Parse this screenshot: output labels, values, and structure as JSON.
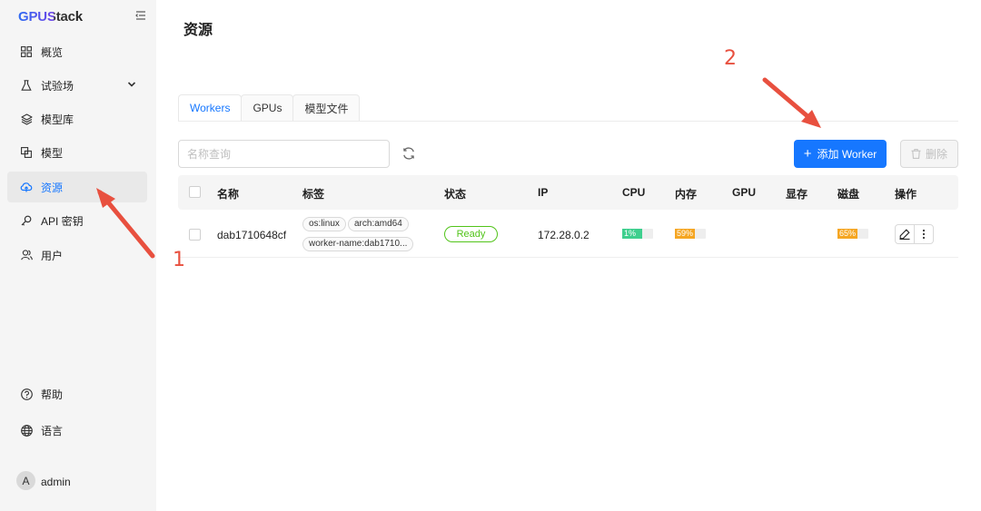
{
  "app": {
    "logo": "GPUStack"
  },
  "sidebar": {
    "items": [
      {
        "label": "概览",
        "icon": "dashboard-icon"
      },
      {
        "label": "试验场",
        "icon": "flask-icon",
        "expandable": true
      },
      {
        "label": "模型库",
        "icon": "layers-icon"
      },
      {
        "label": "模型",
        "icon": "models-icon"
      },
      {
        "label": "资源",
        "icon": "cloud-icon",
        "active": true
      },
      {
        "label": "API 密钥",
        "icon": "key-icon"
      },
      {
        "label": "用户",
        "icon": "users-icon"
      }
    ],
    "bottom": [
      {
        "label": "帮助",
        "icon": "help-icon"
      },
      {
        "label": "语言",
        "icon": "globe-icon"
      }
    ],
    "user": {
      "avatar_letter": "A",
      "name": "admin"
    }
  },
  "page": {
    "title": "资源"
  },
  "tabs": [
    {
      "label": "Workers",
      "active": true
    },
    {
      "label": "GPUs"
    },
    {
      "label": "模型文件"
    }
  ],
  "toolbar": {
    "search_placeholder": "名称查询",
    "add_label": "添加 Worker",
    "delete_label": "删除"
  },
  "table": {
    "headers": {
      "name": "名称",
      "labels": "标签",
      "status": "状态",
      "ip": "IP",
      "cpu": "CPU",
      "memory": "内存",
      "gpu": "GPU",
      "vram": "显存",
      "disk": "磁盘",
      "actions": "操作"
    },
    "rows": [
      {
        "name": "dab1710648cf",
        "tags": [
          "os:linux",
          "arch:amd64",
          "worker-name:dab1710..."
        ],
        "status": "Ready",
        "ip": "172.28.0.2",
        "cpu": {
          "label": "1%",
          "value": 1,
          "color": "#3ecf8e"
        },
        "memory": {
          "label": "59%",
          "value": 59,
          "color": "#f5a623"
        },
        "disk": {
          "label": "65%",
          "value": 65,
          "color": "#f5a623"
        }
      }
    ]
  },
  "annotations": {
    "marker_1": "1",
    "marker_2": "2",
    "color": "#e8503f"
  }
}
